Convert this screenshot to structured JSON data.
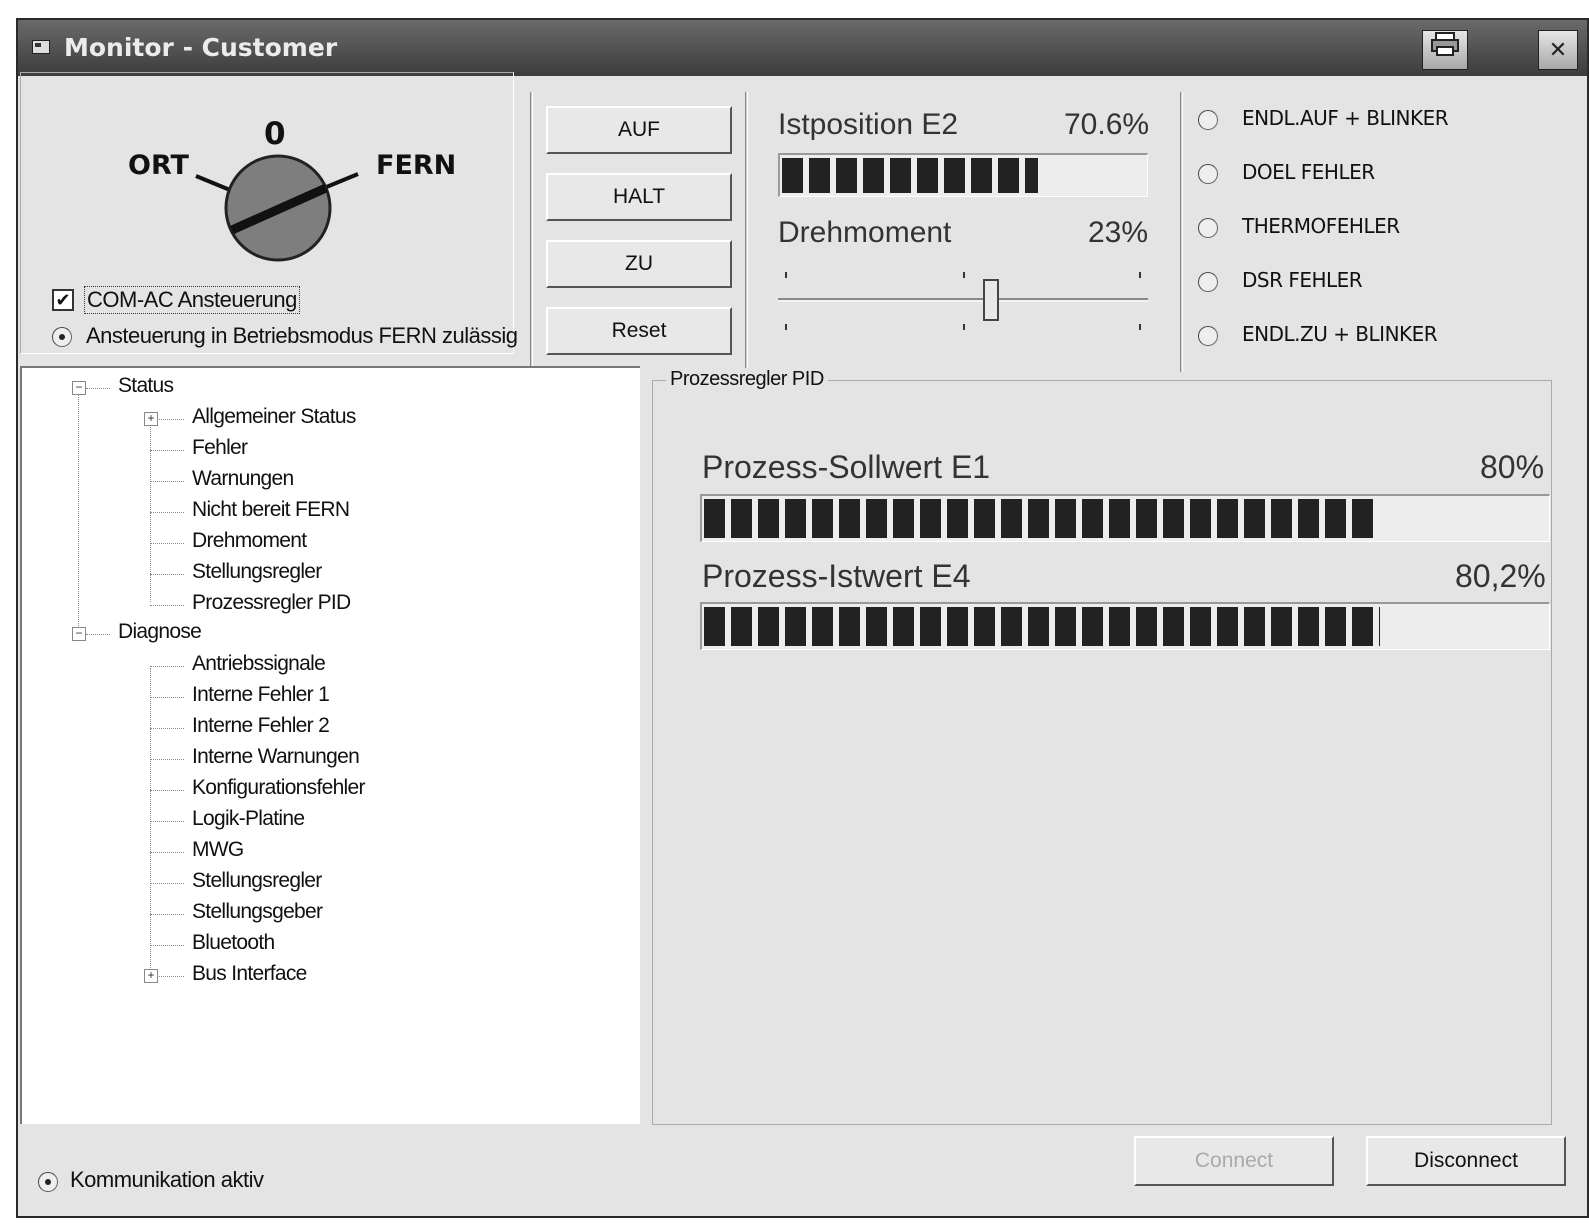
{
  "window": {
    "title": "Monitor - Customer"
  },
  "icons": {
    "system": "window-icon",
    "print": "printer-icon",
    "close": "close-icon"
  },
  "control": {
    "knob_left_label": "ORT",
    "knob_top_label": "0",
    "knob_right_label": "FERN",
    "checkbox_label": "COM-AC Ansteuerung",
    "checkbox_checked": true,
    "radio_label": "Ansteuerung in Betriebsmodus FERN zulässig"
  },
  "buttons": {
    "open": "AUF",
    "stop": "HALT",
    "close": "ZU",
    "reset": "Reset"
  },
  "position": {
    "label": "Istposition E2",
    "value": "70.6%",
    "fraction": 0.706
  },
  "torque": {
    "label": "Drehmoment",
    "value": "23%",
    "fraction": 0.23
  },
  "indicators": [
    {
      "label": "ENDL.AUF + BLINKER"
    },
    {
      "label": "DOEL FEHLER"
    },
    {
      "label": "THERMOFEHLER"
    },
    {
      "label": "DSR FEHLER"
    },
    {
      "label": "ENDL.ZU + BLINKER"
    }
  ],
  "tree": {
    "status": "Status",
    "status_children": [
      "Allgemeiner Status",
      "Fehler",
      "Warnungen",
      "Nicht bereit FERN",
      "Drehmoment",
      "Stellungsregler",
      "Prozessregler PID"
    ],
    "diagnose": "Diagnose",
    "diagnose_children": [
      "Antriebssignale",
      "Interne Fehler 1",
      "Interne Fehler 2",
      "Interne Warnungen",
      "Konfigurationsfehler",
      "Logik-Platine",
      "MWG",
      "Stellungsregler",
      "Stellungsgeber",
      "Bluetooth",
      "Bus Interface"
    ]
  },
  "pid": {
    "group_label": "Prozessregler PID",
    "setpoint": {
      "label": "Prozess-Sollwert E1",
      "value": "80%",
      "fraction": 0.8
    },
    "actual": {
      "label": "Prozess-Istwert E4",
      "value": "80,2%",
      "fraction": 0.802
    }
  },
  "status": {
    "communication": "Kommunikation aktiv"
  },
  "footer": {
    "connect": "Connect",
    "disconnect": "Disconnect"
  }
}
